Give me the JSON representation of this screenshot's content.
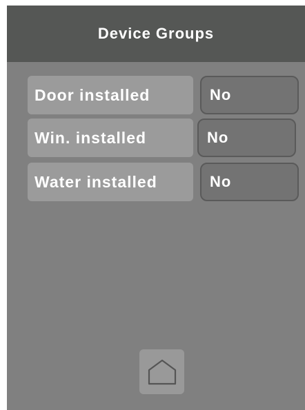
{
  "header": {
    "title": "Device Groups"
  },
  "rows": [
    {
      "label": "Door installed",
      "value": "No"
    },
    {
      "label": "Win. installed",
      "value": "No"
    },
    {
      "label": "Water installed",
      "value": "No"
    }
  ],
  "footer": {
    "home_icon": "home-icon"
  },
  "colors": {
    "header_bg": "#555755",
    "screen_bg": "#808080",
    "label_bg": "#9b9b9b",
    "value_bg": "#737373",
    "value_border": "#5a5a5a",
    "home_button_bg": "#999999",
    "text": "#ffffff"
  }
}
